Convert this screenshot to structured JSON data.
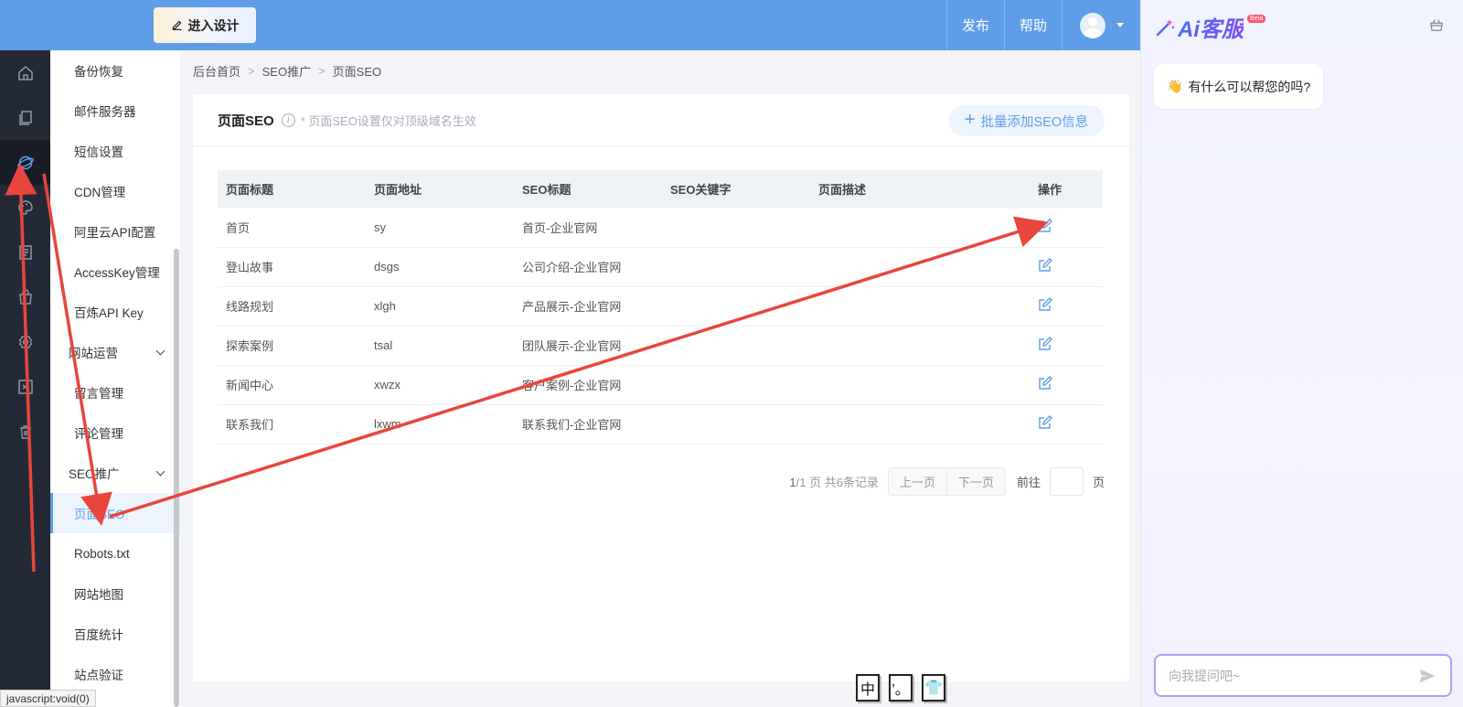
{
  "topbar": {
    "design_button": "进入设计",
    "publish": "发布",
    "help": "帮助"
  },
  "rail_icons": [
    "home-icon",
    "pages-icon",
    "globe-icon",
    "palette-icon",
    "document-icon",
    "bag-icon",
    "gear-icon",
    "terminal-icon",
    "trash-icon"
  ],
  "submenu": {
    "items_top": [
      "备份恢复",
      "邮件服务器",
      "短信设置",
      "CDN管理",
      "阿里云API配置",
      "AccessKey管理",
      "百炼API Key"
    ],
    "group_site_ops": "网站运营",
    "items_site_ops": [
      "留言管理",
      "评论管理"
    ],
    "group_seo": "SEO推广",
    "items_seo": [
      "页面SEO",
      "Robots.txt",
      "网站地图",
      "百度统计",
      "站点验证"
    ]
  },
  "breadcrumb": [
    "后台首页",
    "SEO推广",
    "页面SEO"
  ],
  "panel": {
    "title": "页面SEO",
    "note": "* 页面SEO设置仅对顶级域名生效",
    "batch_button": "批量添加SEO信息"
  },
  "table": {
    "headers": [
      "页面标题",
      "页面地址",
      "SEO标题",
      "SEO关键字",
      "页面描述",
      "操作"
    ],
    "rows": [
      {
        "title": "首页",
        "url": "sy",
        "seo_title": "首页-企业官网",
        "keywords": "",
        "desc": ""
      },
      {
        "title": "登山故事",
        "url": "dsgs",
        "seo_title": "公司介绍-企业官网",
        "keywords": "",
        "desc": ""
      },
      {
        "title": "线路规划",
        "url": "xlgh",
        "seo_title": "产品展示-企业官网",
        "keywords": "",
        "desc": ""
      },
      {
        "title": "探索案例",
        "url": "tsal",
        "seo_title": "团队展示-企业官网",
        "keywords": "",
        "desc": ""
      },
      {
        "title": "新闻中心",
        "url": "xwzx",
        "seo_title": "客户案例-企业官网",
        "keywords": "",
        "desc": ""
      },
      {
        "title": "联系我们",
        "url": "lxwm",
        "seo_title": "联系我们-企业官网",
        "keywords": "",
        "desc": ""
      }
    ]
  },
  "pager": {
    "current": "1",
    "total_pages": "/1 页",
    "records": "共6条记录",
    "prev": "上一页",
    "next": "下一页",
    "goto": "前往",
    "page_unit": "页",
    "page_input": ""
  },
  "ime": [
    "中",
    "’。",
    "👕"
  ],
  "status_bar": "javascript:void(0)",
  "ai": {
    "logo_text": "Ai客服",
    "beta": "Beta",
    "greeting": "有什么可以帮您的吗?",
    "greeting_emoji": "👋",
    "input_placeholder": "向我提问吧~"
  },
  "colors": {
    "primary": "#5f9de8",
    "rail_bg": "#232a36",
    "annotation_red": "#e8453c"
  }
}
